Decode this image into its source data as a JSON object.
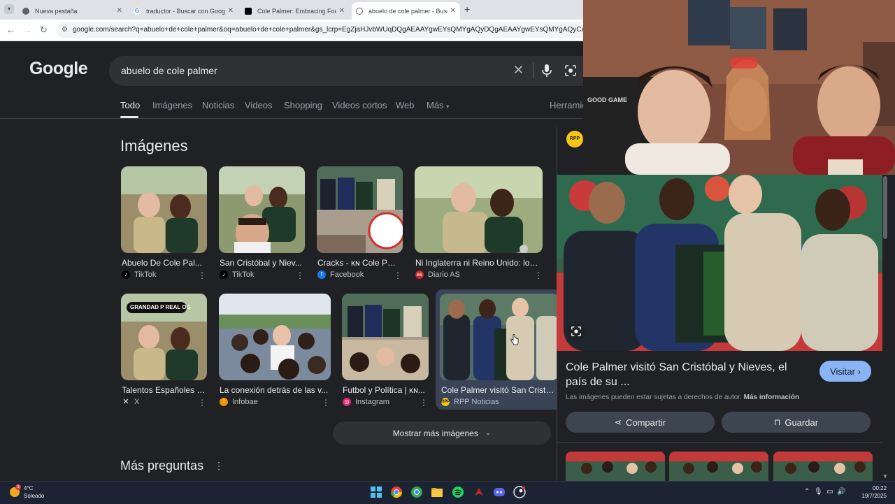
{
  "browser": {
    "tabs": [
      {
        "title": "Nueva pestaña",
        "favicon": "chrome-icon",
        "active": false
      },
      {
        "title": "traductor - Buscar con Google",
        "favicon": "google-icon",
        "active": false
      },
      {
        "title": "Cole Palmer: Embracing Footba",
        "favicon": "tiktok-icon",
        "active": false
      },
      {
        "title": "abuelo de cole palmer - Busca",
        "favicon": "globe-icon",
        "active": true
      }
    ],
    "url": "google.com/search?q=abuelo+de+cole+palmer&oq=abuelo+de+cole+palmer&gs_lcrp=EgZjaHJvbWUqDQgAEAAYgwEYsQMYgAQyDQgAEAAYgwEYsQMYgAQyCAgBEAAYFhgeMgoIAhAAGBYYHhgw"
  },
  "search": {
    "query": "abuelo de cole palmer",
    "logo": "Google"
  },
  "nav_tabs": [
    "Todo",
    "Imágenes",
    "Noticias",
    "Videos",
    "Shopping",
    "Videos cortos",
    "Web",
    "Más"
  ],
  "tools_label": "Herramie",
  "images_heading": "Imágenes",
  "image_results": [
    {
      "caption": "Abuelo De Cole Pal...",
      "source": "TikTok"
    },
    {
      "caption": "San Cristóbal y Niev...",
      "source": "TikTok"
    },
    {
      "caption": "Cracks - ᴋɴ Cole Pal...",
      "source": "Facebook"
    },
    {
      "caption": "Ni Inglaterra ni Reino Unido: los ...",
      "source": "Diario AS"
    },
    {
      "caption": "Talentos Españoles /...",
      "source": "X",
      "overlay": "GRANDAD P REAL OG"
    },
    {
      "caption": "La conexión detrás de las v...",
      "source": "Infobae"
    },
    {
      "caption": "Futbol y Política | ᴋɴ...",
      "source": "Instagram"
    },
    {
      "caption": "Cole Palmer visitó San Cristóba",
      "source": "RPP Noticias"
    }
  ],
  "show_more_label": "Mostrar más imágenes",
  "more_questions_label": "Más preguntas",
  "panel": {
    "source_logo": "RPP",
    "title": "Cole Palmer visitó San Cristóbal y Nieves, el país de su ...",
    "visit_label": "Visitar",
    "copyright_text": "Las imágenes pueden estar sujetas a derechos de autor.",
    "more_info_label": "Más información",
    "share_label": "Compartir",
    "save_label": "Guardar"
  },
  "webcam": {
    "chair_text": "GOOD GAME"
  },
  "taskbar": {
    "weather_badge": "3",
    "temperature": "4°C",
    "weather": "Soleado",
    "time": "00:22",
    "date": "19/7/2025",
    "apps": [
      "windows-icon",
      "chrome-icon",
      "chrome-profile-icon",
      "file-explorer-icon",
      "spotify-icon",
      "game-app-icon",
      "discord-icon",
      "steam-icon"
    ]
  },
  "colors": {
    "accent": "#8ab4f8",
    "background": "#202124",
    "surface": "#303134"
  }
}
